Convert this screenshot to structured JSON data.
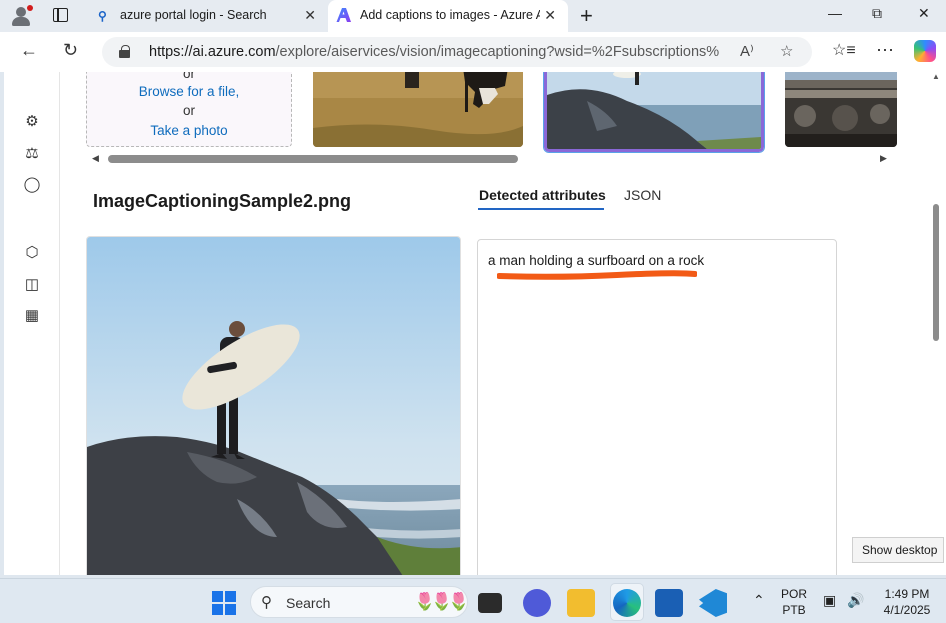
{
  "browser": {
    "tabs": [
      {
        "title": "azure portal login - Search",
        "active": false
      },
      {
        "title": "Add captions to images - Azure A",
        "active": true
      }
    ],
    "url_host": "https://ai.azure.com",
    "url_path": "/explore/aiservices/vision/imagecaptioning?wsid=%2Fsubscriptions%2..."
  },
  "upload": {
    "or_top": "or",
    "browse_link": "Browse for a file,",
    "or_bottom": "or",
    "photo_link": "Take a photo"
  },
  "image_title": "ImageCaptioningSample2.png",
  "result_tabs": {
    "detected": "Detected attributes",
    "json": "JSON"
  },
  "caption": "a man holding a surfboard on a rock",
  "tooltip": "Show desktop",
  "taskbar": {
    "search_label": "Search",
    "language": "POR",
    "layout": "PTB",
    "time": "1:49 PM",
    "date": "4/1/2025"
  },
  "colors": {
    "accent": "#0f6cbd",
    "highlight_marker": "#f25a16",
    "selected_thumb_border": "#8a68d8",
    "tab_underline": "#2266c4"
  }
}
